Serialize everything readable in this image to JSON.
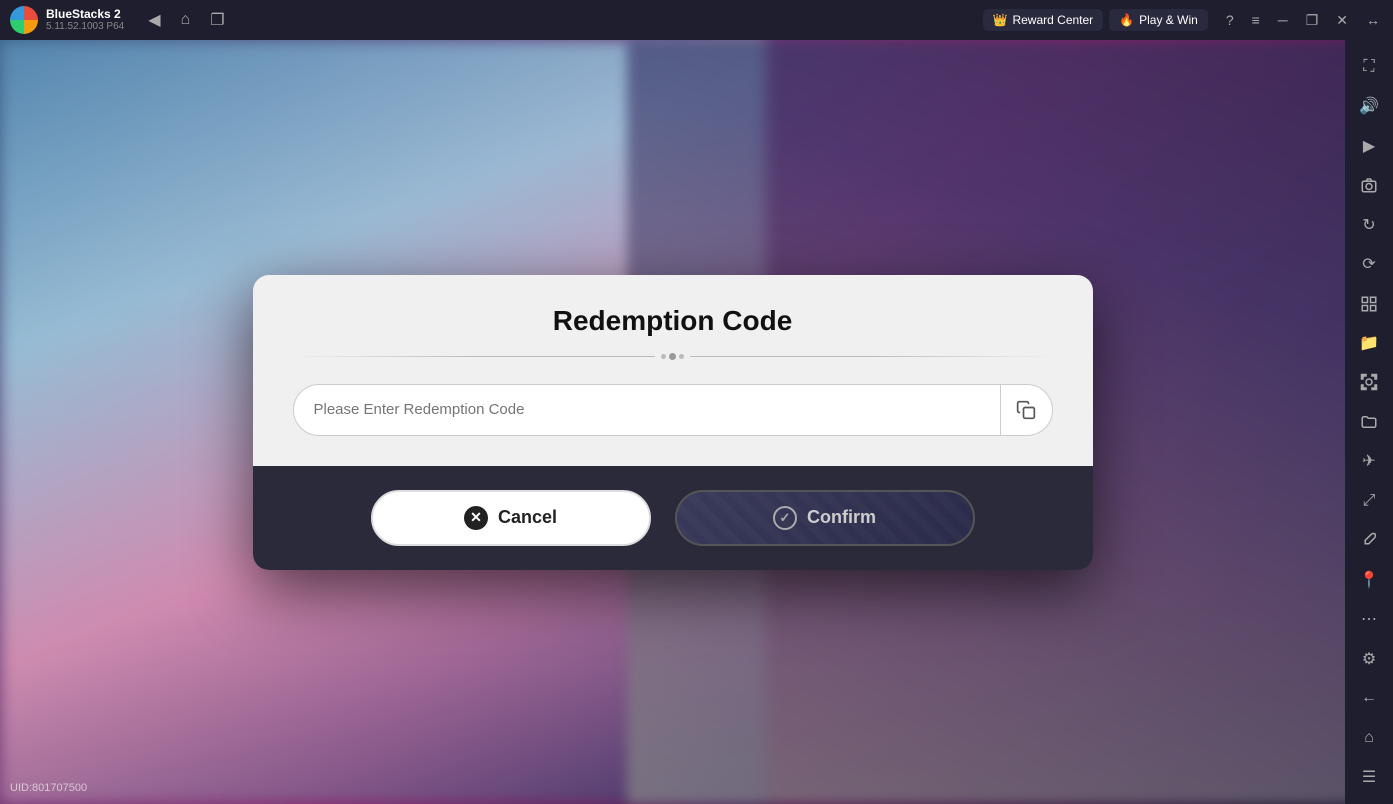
{
  "titlebar": {
    "app_name": "BlueStacks 2",
    "app_version": "5.11.52.1003  P64",
    "reward_center_label": "Reward Center",
    "play_win_label": "Play & Win",
    "back_icon": "◀",
    "home_icon": "⌂",
    "bookmarks_icon": "❐",
    "minimize_label": "─",
    "maximize_label": "❐",
    "close_label": "✕",
    "expand_icon": "↔"
  },
  "sidebar": {
    "icons": [
      {
        "name": "fullscreen-icon",
        "symbol": "⛶"
      },
      {
        "name": "volume-icon",
        "symbol": "🔊"
      },
      {
        "name": "video-icon",
        "symbol": "▶"
      },
      {
        "name": "camera-icon",
        "symbol": "📷"
      },
      {
        "name": "rotate-icon",
        "symbol": "↻"
      },
      {
        "name": "refresh-icon",
        "symbol": "⟳"
      },
      {
        "name": "apps-icon",
        "symbol": "⊞"
      },
      {
        "name": "media-icon",
        "symbol": "📁"
      },
      {
        "name": "screenshot-icon",
        "symbol": "📸"
      },
      {
        "name": "folder-icon",
        "symbol": "📂"
      },
      {
        "name": "flight-icon",
        "symbol": "✈"
      },
      {
        "name": "resize-icon",
        "symbol": "⤢"
      },
      {
        "name": "brush-icon",
        "symbol": "🖌"
      },
      {
        "name": "location-icon",
        "symbol": "📍"
      },
      {
        "name": "more-icon",
        "symbol": "⋯"
      },
      {
        "name": "settings-icon",
        "symbol": "⚙"
      },
      {
        "name": "back-icon",
        "symbol": "←"
      },
      {
        "name": "home-sidebar-icon",
        "symbol": "⌂"
      },
      {
        "name": "menu-icon",
        "symbol": "☰"
      }
    ]
  },
  "dialog": {
    "title": "Redemption Code",
    "input_placeholder": "Please Enter Redemption Code",
    "cancel_label": "Cancel",
    "confirm_label": "Confirm"
  },
  "footer": {
    "uid_label": "UID:801707500"
  }
}
